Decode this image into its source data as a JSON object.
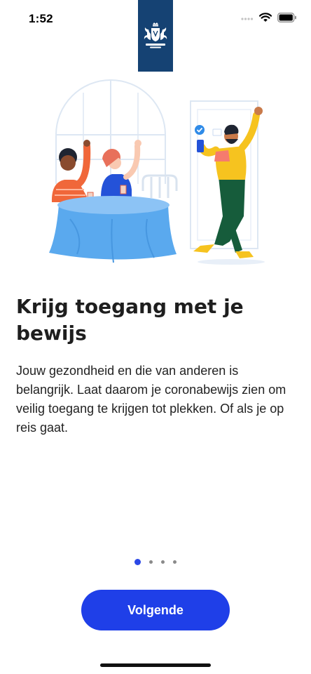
{
  "status_bar": {
    "time": "1:52"
  },
  "onboarding": {
    "title": "Krijg toegang met je bewijs",
    "body": "Jouw gezondheid en die van anderen is belangrijk. Laat daarom je coronabewijs zien om veilig toegang te krijgen tot plekken. Of als je op reis gaat.",
    "page_index": 1,
    "page_count": 4,
    "next_label": "Volgende"
  },
  "colors": {
    "logo_blue": "#154273",
    "accent": "#1f3fe8",
    "active_dot": "#2b48e6",
    "inactive_dot": "#8a8a8a"
  },
  "icons": [
    "wifi-icon",
    "battery-icon",
    "cellular-signal-icon",
    "royal-coat-of-arms-logo",
    "checkmark-badge-icon"
  ]
}
